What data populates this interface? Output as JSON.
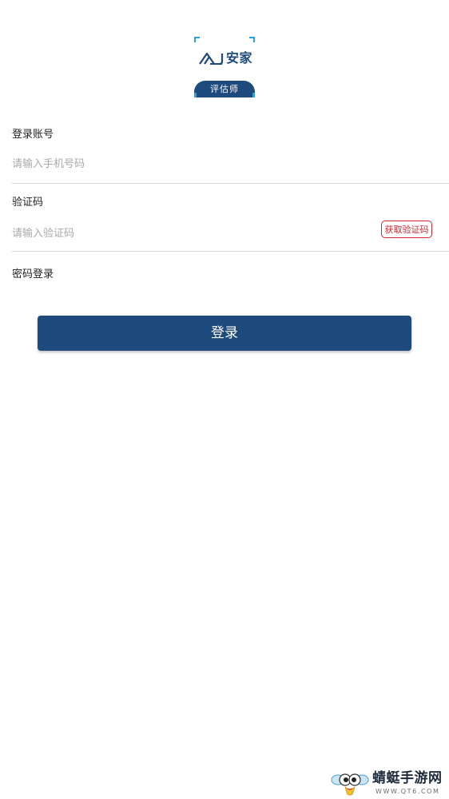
{
  "logo": {
    "brand_text": "安家",
    "badge_text": "评估师"
  },
  "login_form": {
    "account": {
      "label": "登录账号",
      "placeholder": "请输入手机号码",
      "value": ""
    },
    "code": {
      "label": "验证码",
      "placeholder": "请输入验证码",
      "value": "",
      "get_code_label": "获取验证码"
    },
    "password_login_label": "密码登录",
    "submit_label": "登录"
  },
  "watermark": {
    "text": "蜻蜓手游网",
    "url": "WWW.QT6.COM"
  },
  "colors": {
    "primary": "#1e4a7e",
    "accent_red": "#d6262f",
    "logo_corner": "#2aa3d8",
    "placeholder": "#a9a9a9",
    "divider": "#d9d9d9"
  }
}
